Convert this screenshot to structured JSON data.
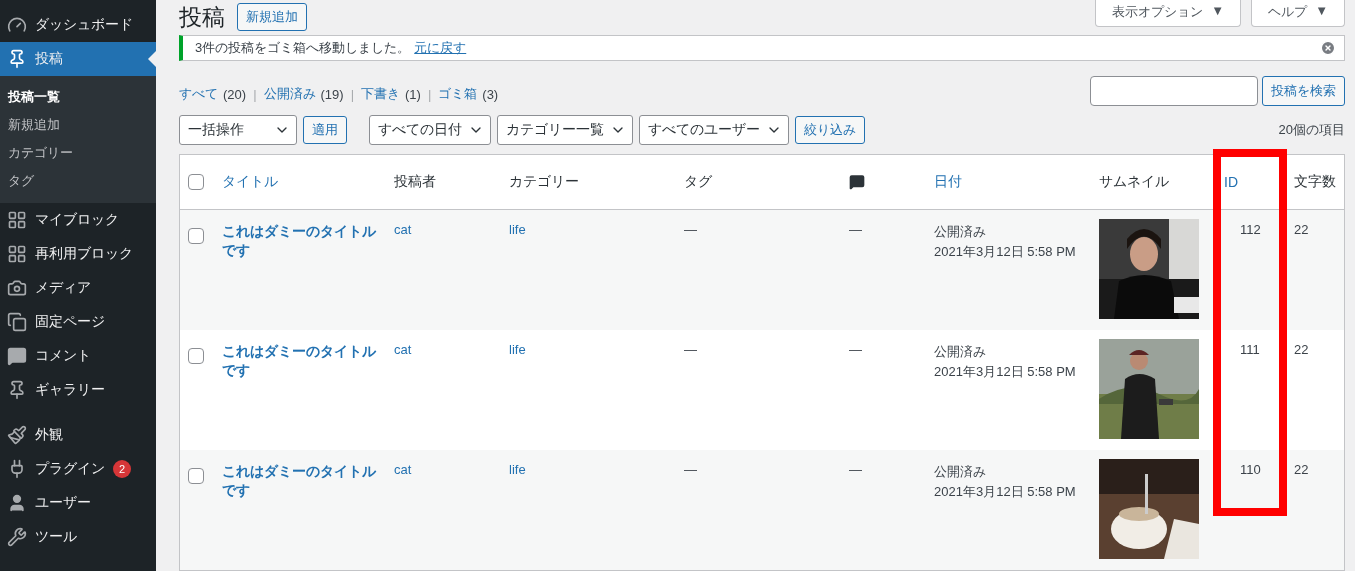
{
  "sidebar": {
    "groups": [
      {
        "items": [
          {
            "label": "ダッシュボード",
            "kind": "dashboard",
            "selected": false
          },
          {
            "label": "投稿",
            "kind": "pin",
            "selected": true,
            "children": [
              {
                "label": "投稿一覧",
                "selected": true
              },
              {
                "label": "新規追加",
                "selected": false
              },
              {
                "label": "カテゴリー",
                "selected": false
              },
              {
                "label": "タグ",
                "selected": false
              }
            ]
          },
          {
            "label": "マイブロック",
            "kind": "grid",
            "selected": false
          },
          {
            "label": "再利用ブロック",
            "kind": "grid",
            "selected": false
          },
          {
            "label": "メディア",
            "kind": "media",
            "selected": false
          },
          {
            "label": "固定ページ",
            "kind": "pages",
            "selected": false
          },
          {
            "label": "コメント",
            "kind": "comment",
            "selected": false
          },
          {
            "label": "ギャラリー",
            "kind": "pin",
            "selected": false
          }
        ]
      },
      {
        "items": [
          {
            "label": "外観",
            "kind": "brush",
            "selected": false
          },
          {
            "label": "プラグイン",
            "kind": "plugin",
            "selected": false,
            "badge": "2"
          },
          {
            "label": "ユーザー",
            "kind": "user",
            "selected": false
          },
          {
            "label": "ツール",
            "kind": "tool",
            "selected": false
          }
        ]
      }
    ]
  },
  "screen_tabs": [
    {
      "label": "表示オプション",
      "arrow": "▼"
    },
    {
      "label": "ヘルプ",
      "arrow": "▼"
    }
  ],
  "page_title": "投稿",
  "add_new": "新規追加",
  "notice": {
    "message": "3件の投稿をゴミ箱へ移動しました。",
    "link": "元に戻す"
  },
  "views": [
    {
      "label": "すべて",
      "count": "(20)"
    },
    {
      "separator": "|",
      "label": "公開済み",
      "count": "(19)"
    },
    {
      "separator": "|",
      "label": "下書き",
      "count": "(1)"
    },
    {
      "separator": "|",
      "label": "ゴミ箱",
      "count": "(3)"
    }
  ],
  "search": {
    "button": "投稿を検索"
  },
  "bulk": {
    "select": "一括操作",
    "apply": "適用"
  },
  "filters": [
    "すべての日付",
    "カテゴリー一覧",
    "すべてのユーザー"
  ],
  "filter_button": "絞り込み",
  "item_count": "20個の項目",
  "table": {
    "columns": [
      {
        "kind": "checkbox",
        "checked": false,
        "highlighted": false
      },
      {
        "kind": "link",
        "label": "タイトル",
        "highlighted": false
      },
      {
        "kind": "text",
        "label": "投稿者",
        "highlighted": false
      },
      {
        "kind": "text",
        "label": "カテゴリー",
        "highlighted": false
      },
      {
        "kind": "text",
        "label": "タグ",
        "highlighted": false
      },
      {
        "kind": "comment",
        "highlighted": false
      },
      {
        "kind": "link",
        "label": "日付",
        "highlighted": false
      },
      {
        "kind": "text",
        "label": "サムネイル",
        "highlighted": false
      },
      {
        "kind": "link",
        "label": "ID",
        "highlighted": true
      },
      {
        "kind": "text",
        "label": "文字数",
        "highlighted": false
      }
    ],
    "rows": [
      {
        "checked": false,
        "title": "これはダミーのタイトルです",
        "author": "cat",
        "category": "life",
        "tags": "—",
        "comments": "—",
        "status": "公開済み",
        "date": "2021年3月12日 5:58 PM",
        "id": "112",
        "word_count": "22"
      },
      {
        "checked": false,
        "title": "これはダミーのタイトルです",
        "author": "cat",
        "category": "life",
        "tags": "—",
        "comments": "—",
        "status": "公開済み",
        "date": "2021年3月12日 5:58 PM",
        "id": "111",
        "word_count": "22"
      },
      {
        "checked": false,
        "title": "これはダミーのタイトルです",
        "author": "cat",
        "category": "life",
        "tags": "—",
        "comments": "—",
        "status": "公開済み",
        "date": "2021年3月12日 5:58 PM",
        "id": "110",
        "word_count": "22"
      }
    ]
  }
}
